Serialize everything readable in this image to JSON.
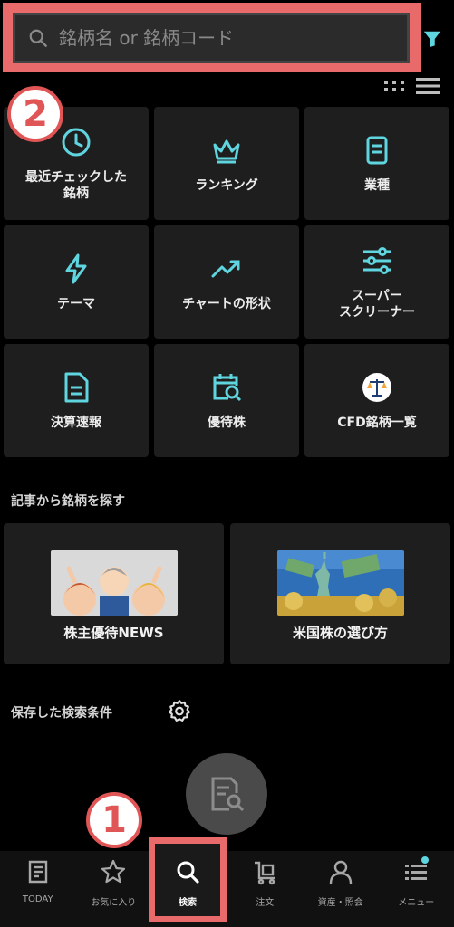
{
  "search": {
    "placeholder": "銘柄名 or 銘柄コード"
  },
  "badges": {
    "step1": "1",
    "step2": "2"
  },
  "menu": [
    {
      "label": "最近チェックした\n銘柄",
      "icon": "clock-icon"
    },
    {
      "label": "ランキング",
      "icon": "crown-icon"
    },
    {
      "label": "業種",
      "icon": "document-icon"
    },
    {
      "label": "テーマ",
      "icon": "lightning-icon"
    },
    {
      "label": "チャートの形状",
      "icon": "trending-up-icon"
    },
    {
      "label": "スーパー\nスクリーナー",
      "icon": "sliders-icon"
    },
    {
      "label": "決算速報",
      "icon": "report-icon"
    },
    {
      "label": "優待株",
      "icon": "calendar-search-icon"
    },
    {
      "label": "CFD銘柄一覧",
      "icon": "scale-icon"
    }
  ],
  "articles": {
    "section_title": "記事から銘柄を探す",
    "items": [
      {
        "label": "株主優待NEWS"
      },
      {
        "label": "米国株の選び方"
      }
    ]
  },
  "saved": {
    "section_title": "保存した検索条件"
  },
  "nav": [
    {
      "label": "TODAY",
      "icon": "today-icon"
    },
    {
      "label": "お気に入り",
      "icon": "star-icon"
    },
    {
      "label": "検索",
      "icon": "search-icon",
      "active": true
    },
    {
      "label": "注文",
      "icon": "cart-icon"
    },
    {
      "label": "資産・照会",
      "icon": "person-icon"
    },
    {
      "label": "メニュー",
      "icon": "menu-icon"
    }
  ],
  "colors": {
    "accent": "#5FD5E0",
    "highlight": "#E96A6A",
    "tile_bg": "#1E1E1E"
  }
}
